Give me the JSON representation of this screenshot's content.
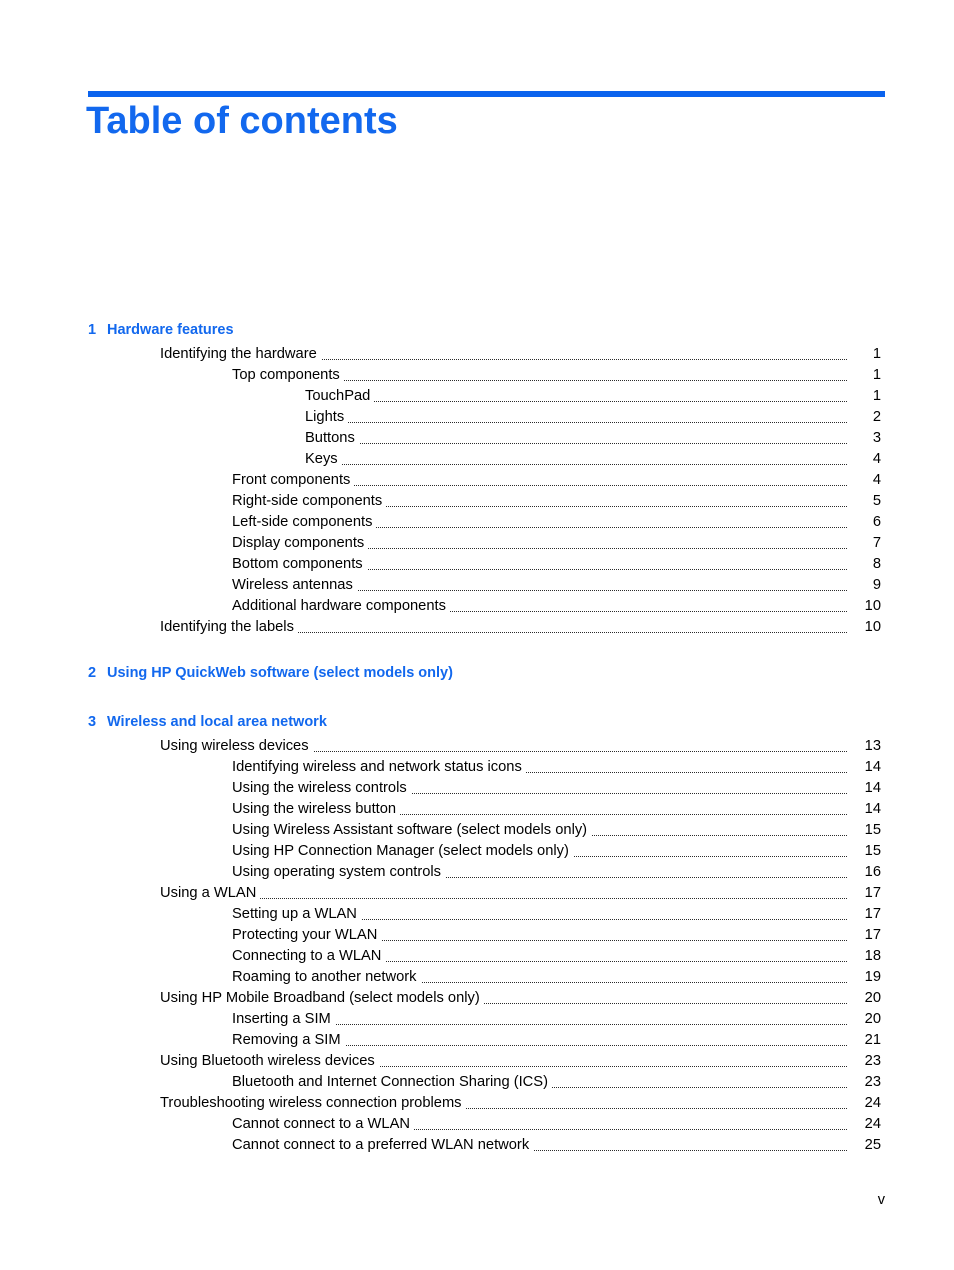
{
  "document": {
    "title": "Table of contents",
    "accent_color": "#1268EE",
    "rule_color": "#0B63EE",
    "footer_page_label": "v"
  },
  "chapters": [
    {
      "number": "1",
      "title": "Hardware features",
      "entries": [
        {
          "label": "Identifying the hardware",
          "page": "1",
          "level": 1
        },
        {
          "label": "Top components",
          "page": "1",
          "level": 2
        },
        {
          "label": "TouchPad",
          "page": "1",
          "level": 3
        },
        {
          "label": "Lights",
          "page": "2",
          "level": 3
        },
        {
          "label": "Buttons",
          "page": "3",
          "level": 3
        },
        {
          "label": "Keys",
          "page": "4",
          "level": 3
        },
        {
          "label": "Front components",
          "page": "4",
          "level": 2
        },
        {
          "label": "Right-side components",
          "page": "5",
          "level": 2
        },
        {
          "label": "Left-side components",
          "page": "6",
          "level": 2
        },
        {
          "label": "Display components",
          "page": "7",
          "level": 2
        },
        {
          "label": "Bottom components",
          "page": "8",
          "level": 2
        },
        {
          "label": "Wireless antennas",
          "page": "9",
          "level": 2
        },
        {
          "label": "Additional hardware components",
          "page": "10",
          "level": 2
        },
        {
          "label": "Identifying the labels",
          "page": "10",
          "level": 1
        }
      ]
    },
    {
      "number": "2",
      "title": "Using HP QuickWeb software (select models only)",
      "entries": []
    },
    {
      "number": "3",
      "title": "Wireless and local area network",
      "entries": [
        {
          "label": "Using wireless devices",
          "page": "13",
          "level": 1
        },
        {
          "label": "Identifying wireless and network status icons",
          "page": "14",
          "level": 2
        },
        {
          "label": "Using the wireless controls",
          "page": "14",
          "level": 2
        },
        {
          "label": "Using the wireless button",
          "page": "14",
          "level": 2
        },
        {
          "label": "Using Wireless Assistant software (select models only)",
          "page": "15",
          "level": 2
        },
        {
          "label": "Using HP Connection Manager (select models only)",
          "page": "15",
          "level": 2
        },
        {
          "label": "Using operating system controls",
          "page": "16",
          "level": 2
        },
        {
          "label": "Using a WLAN",
          "page": "17",
          "level": 1
        },
        {
          "label": "Setting up a WLAN",
          "page": "17",
          "level": 2
        },
        {
          "label": "Protecting your WLAN",
          "page": "17",
          "level": 2
        },
        {
          "label": "Connecting to a WLAN",
          "page": "18",
          "level": 2
        },
        {
          "label": "Roaming to another network",
          "page": "19",
          "level": 2
        },
        {
          "label": "Using HP Mobile Broadband (select models only)",
          "page": "20",
          "level": 1
        },
        {
          "label": "Inserting a SIM",
          "page": "20",
          "level": 2
        },
        {
          "label": "Removing a SIM",
          "page": "21",
          "level": 2
        },
        {
          "label": "Using Bluetooth wireless devices",
          "page": "23",
          "level": 1
        },
        {
          "label": "Bluetooth and Internet Connection Sharing (ICS)",
          "page": "23",
          "level": 2
        },
        {
          "label": "Troubleshooting wireless connection problems",
          "page": "24",
          "level": 1
        },
        {
          "label": "Cannot connect to a WLAN",
          "page": "24",
          "level": 2
        },
        {
          "label": "Cannot connect to a preferred WLAN network",
          "page": "25",
          "level": 2
        }
      ]
    }
  ]
}
